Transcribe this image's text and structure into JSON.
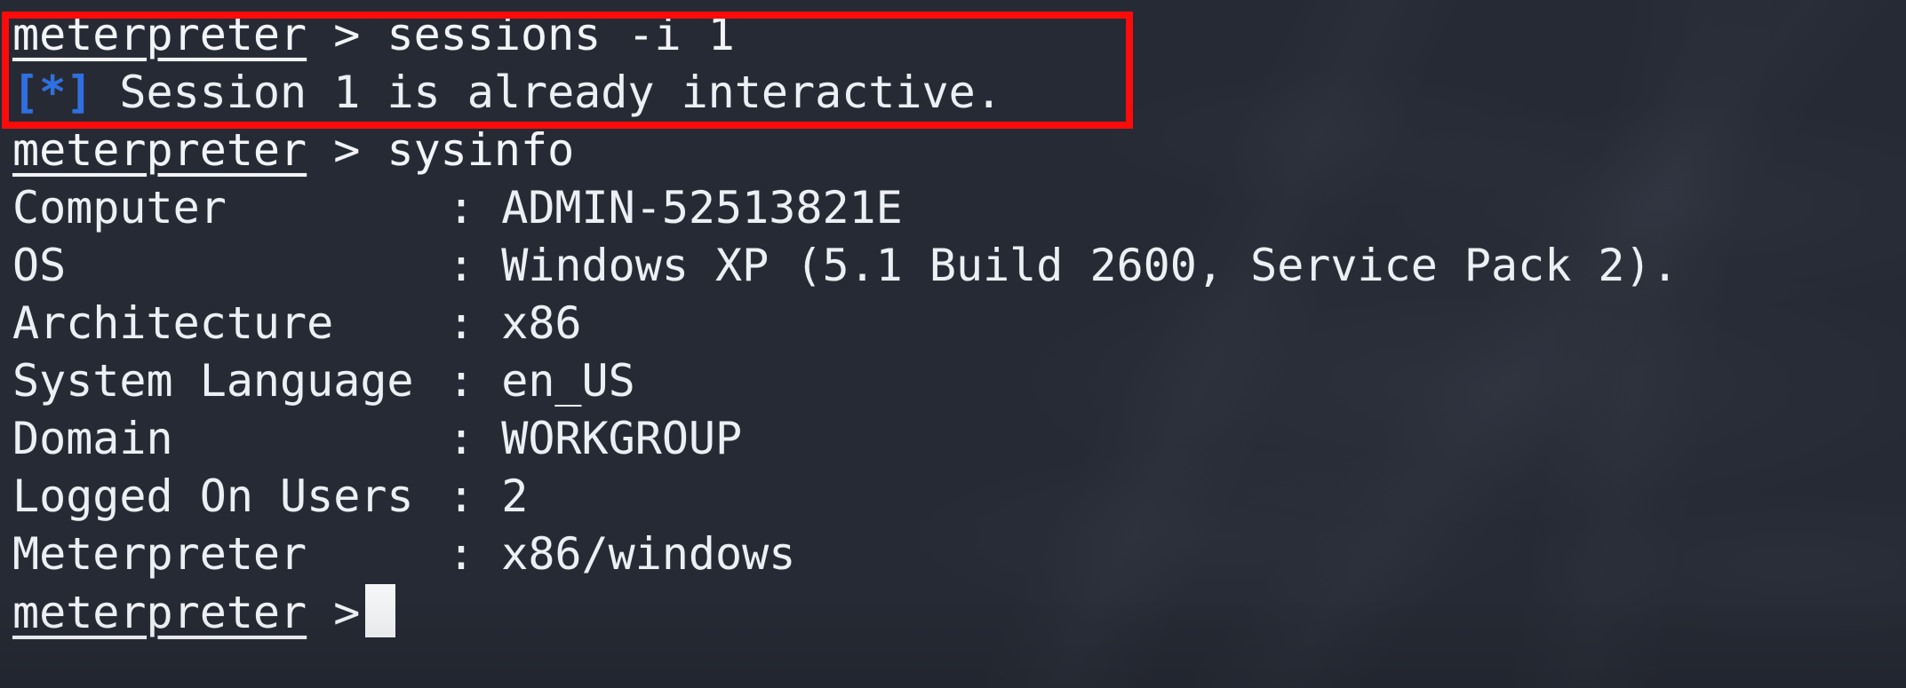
{
  "terminal": {
    "background_color": "#262a34",
    "text_color": "#eceff4",
    "accent_info_color": "#2f6fe4",
    "annotation_color": "#fc0b0b",
    "prompt_label": "meterpreter",
    "prompt_arrow": ">",
    "cursor_glyph": "block-cursor"
  },
  "lines": [
    {
      "id": "line-1",
      "type": "prompt",
      "host": "meterpreter",
      "arrow": ">",
      "command": "sessions -i 1"
    },
    {
      "id": "line-2",
      "type": "info",
      "marker": "[*]",
      "text": "Session 1 is already interactive."
    },
    {
      "id": "line-3",
      "type": "prompt",
      "host": "meterpreter",
      "arrow": ">",
      "command": "sysinfo"
    },
    {
      "id": "line-4",
      "type": "keyvalue",
      "key": "Computer",
      "colon": ":",
      "value": "ADMIN-52513821E"
    },
    {
      "id": "line-5",
      "type": "keyvalue",
      "key": "OS",
      "colon": ":",
      "value": "Windows XP (5.1 Build 2600, Service Pack 2)."
    },
    {
      "id": "line-6",
      "type": "keyvalue",
      "key": "Architecture",
      "colon": ":",
      "value": "x86"
    },
    {
      "id": "line-7",
      "type": "keyvalue",
      "key": "System Language",
      "colon": ":",
      "value": "en_US"
    },
    {
      "id": "line-8",
      "type": "keyvalue",
      "key": "Domain",
      "colon": ":",
      "value": "WORKGROUP"
    },
    {
      "id": "line-9",
      "type": "keyvalue",
      "key": "Logged On Users",
      "colon": ":",
      "value": "2"
    },
    {
      "id": "line-10",
      "type": "keyvalue",
      "key": "Meterpreter",
      "colon": ":",
      "value": "x86/windows"
    },
    {
      "id": "line-11",
      "type": "prompt",
      "host": "meterpreter",
      "arrow": ">",
      "command": ""
    }
  ],
  "annotation": {
    "name": "red-highlight-box",
    "covers": "sessions -i 1 command and its [*] response"
  }
}
